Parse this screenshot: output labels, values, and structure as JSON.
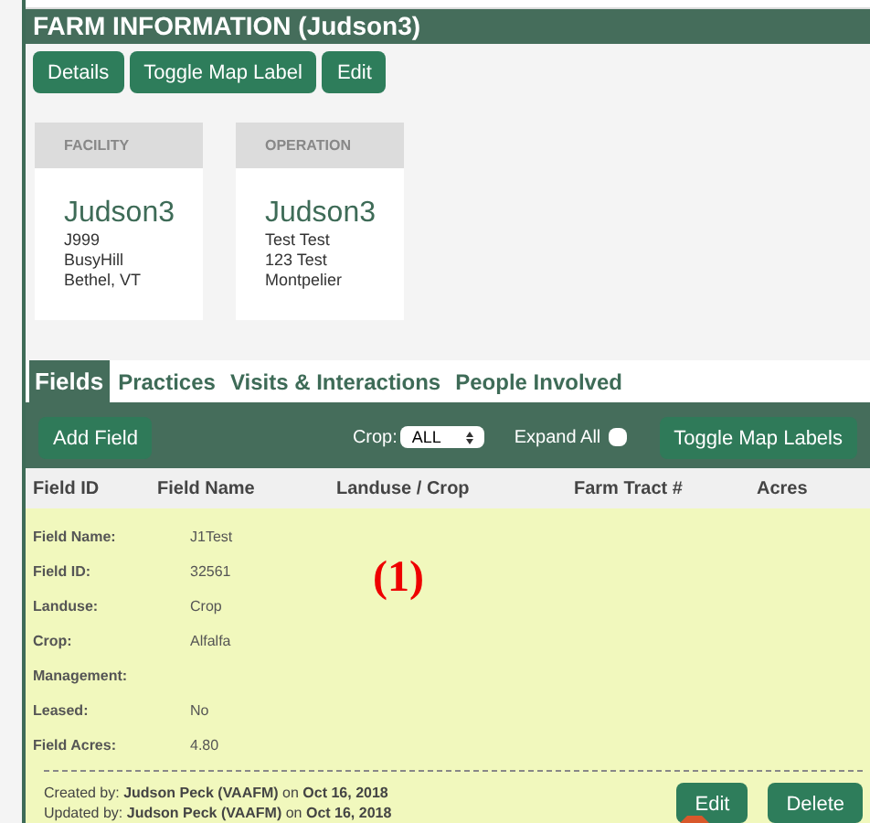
{
  "panel": {
    "title": "FARM INFORMATION (Judson3)",
    "buttons": [
      "Details",
      "Toggle Map Label",
      "Edit"
    ]
  },
  "cards": [
    {
      "header": "FACILITY",
      "name": "Judson3",
      "lines": [
        "J999",
        "BusyHill",
        "Bethel, VT"
      ]
    },
    {
      "header": "OPERATION",
      "name": "Judson3",
      "lines": [
        "Test Test",
        "123 Test",
        "Montpelier"
      ]
    }
  ],
  "tabs": [
    {
      "label": "Fields",
      "selected": true
    },
    {
      "label": "Practices",
      "selected": false
    },
    {
      "label": "Visits & Interactions",
      "selected": false
    },
    {
      "label": "People Involved",
      "selected": false
    }
  ],
  "toolbar": {
    "add_button": "Add Field",
    "crop_label": "Crop:",
    "crop_value": "ALL",
    "expand_label": "Expand All",
    "expand_checked": false,
    "toggle_button": "Toggle Map Labels"
  },
  "table": {
    "columns": [
      "Field ID",
      "Field Name",
      "Landuse / Crop",
      "Farm Tract #",
      "Acres"
    ],
    "details": [
      {
        "label": "Field Name:",
        "value": "J1Test"
      },
      {
        "label": "Field ID:",
        "value": "32561"
      },
      {
        "label": "Landuse:",
        "value": "Crop"
      },
      {
        "label": "Crop:",
        "value": "Alfalfa"
      },
      {
        "label": "Management:"
      },
      {
        "label": "Leased:",
        "value": "No"
      },
      {
        "label": "Field Acres:",
        "value": "4.80"
      }
    ],
    "annotation": "(1)",
    "footer": [
      "Created by: **Judson Peck (VAAFM)** on **Oct 16, 2018**",
      "Updated by: **Judson Peck (VAAFM)** on **Oct 16, 2018**"
    ],
    "buttons": [
      "Edit",
      "Delete"
    ]
  }
}
